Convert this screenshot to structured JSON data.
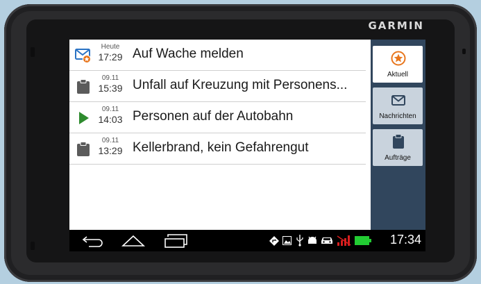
{
  "device": {
    "brand": "GARMIN"
  },
  "messages": [
    {
      "date": "Heute",
      "time": "17:29",
      "title": "Auf Wache melden",
      "icon": "envelope-alert-icon"
    },
    {
      "date": "09.11",
      "time": "15:39",
      "title": "Unfall auf Kreuzung mit Personens...",
      "icon": "clipboard-icon"
    },
    {
      "date": "09.11",
      "time": "14:03",
      "title": "Personen auf der Autobahn",
      "icon": "play-icon"
    },
    {
      "date": "09.11",
      "time": "13:29",
      "title": "Kellerbrand, kein Gefahrengut",
      "icon": "clipboard-icon"
    }
  ],
  "tabs": [
    {
      "label": "Aktuell",
      "icon": "star-circle-icon",
      "active": true
    },
    {
      "label": "Nachrichten",
      "icon": "envelope-icon",
      "active": false
    },
    {
      "label": "Aufträge",
      "icon": "clipboard-icon",
      "active": false
    }
  ],
  "statusbar": {
    "time": "17:34"
  },
  "colors": {
    "tab_panel": "#31465d",
    "accent_orange": "#e8761d",
    "play_green": "#2e8b2e",
    "icon_blue": "#2a73c4",
    "icon_gray": "#5b5b5b",
    "battery_green": "#22cc33"
  }
}
